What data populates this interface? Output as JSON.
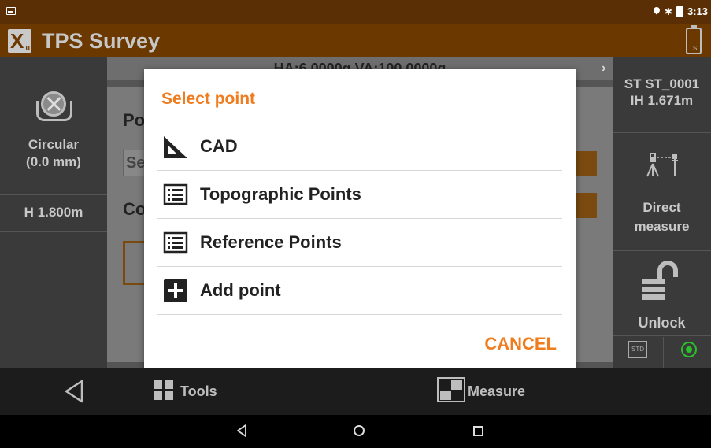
{
  "status_bar": {
    "time": "3:13",
    "bluetooth_glyph": "✱",
    "icons": [
      "picture-icon",
      "location-icon",
      "bluetooth-icon",
      "battery-icon"
    ]
  },
  "app_bar": {
    "title": "TPS Survey",
    "battery_label": "TS"
  },
  "left_panel": {
    "prism_label_line1": "Circular",
    "prism_label_line2": "(0.0 mm)",
    "height": "H 1.800m"
  },
  "right_panel": {
    "station_line1": "ST ST_0001",
    "station_line2": "IH 1.671m",
    "direct_measure_line1": "Direct",
    "direct_measure_line2": "measure",
    "unlock_label": "Unlock",
    "std_label": "STD"
  },
  "background": {
    "angles": "HA:6.0000g VA:100.0000g",
    "po_label": "Po",
    "se_input": "Se",
    "co_label": "Co"
  },
  "dialog": {
    "title": "Select point",
    "options": [
      {
        "label": "CAD",
        "icon": "set-square-icon"
      },
      {
        "label": "Topographic Points",
        "icon": "list-icon"
      },
      {
        "label": "Reference Points",
        "icon": "list-icon"
      },
      {
        "label": "Add point",
        "icon": "plus-icon"
      }
    ],
    "cancel_label": "CANCEL"
  },
  "toolbar": {
    "tools_label": "Tools",
    "measure_label": "Measure"
  },
  "colors": {
    "accent": "#f07c1e",
    "app_bar": "#6b3800",
    "status_bar": "#5a2f05",
    "target_green": "#2bbf2b"
  }
}
